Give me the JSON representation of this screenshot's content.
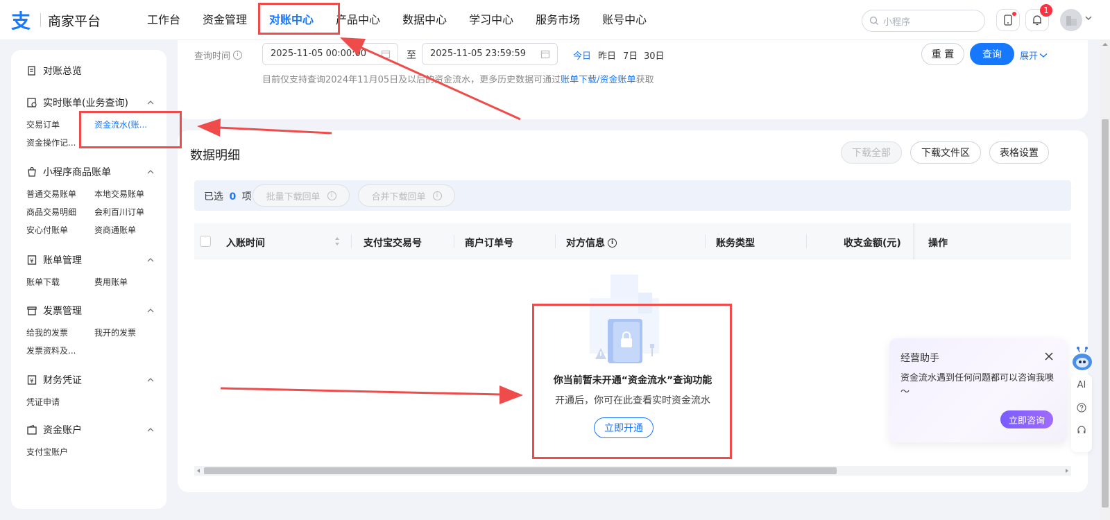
{
  "header": {
    "logo_text": "商家平台",
    "nav": [
      "工作台",
      "资金管理",
      "对账中心",
      "产品中心",
      "数据中心",
      "学习中心",
      "服务市场",
      "账号中心"
    ],
    "active_nav": "对账中心",
    "search_placeholder": "小程序",
    "notification_count": "1"
  },
  "sidebar": {
    "overview": "对账总览",
    "groups": [
      {
        "title": "实时账单(业务查询)",
        "icon": "realtime-bill-icon",
        "items": [
          "交易订单",
          "资金流水(账...",
          "资金操作记..."
        ]
      },
      {
        "title": "小程序商品账单",
        "icon": "miniapp-goods-icon",
        "items": [
          "普通交易账单",
          "本地交易账单",
          "商品交易明细",
          "会利百川订单",
          "安心付账单",
          "资商通账单"
        ]
      },
      {
        "title": "账单管理",
        "icon": "bill-manage-icon",
        "items": [
          "账单下载",
          "费用账单"
        ]
      },
      {
        "title": "发票管理",
        "icon": "invoice-icon",
        "items": [
          "给我的发票",
          "我开的发票",
          "发票资料及..."
        ]
      },
      {
        "title": "财务凭证",
        "icon": "voucher-icon",
        "items": [
          "凭证申请"
        ]
      },
      {
        "title": "资金账户",
        "icon": "wallet-icon",
        "items": [
          "支付宝账户"
        ]
      }
    ],
    "active_item": "资金流水(账..."
  },
  "filter": {
    "label": "查询时间",
    "start": "2025-11-05 00:00:00",
    "to": "至",
    "end": "2025-11-05 23:59:59",
    "quick": [
      "今日",
      "昨日",
      "7日",
      "30日"
    ],
    "hint_prefix": "目前仅支持查询2024年11月05日及以后的资金流水，更多历史数据可通过",
    "hint_link": "账单下载/资金账单",
    "hint_suffix": "获取",
    "reset": "重 置",
    "query": "查询",
    "expand": "展开"
  },
  "detail": {
    "title": "数据明细",
    "download_all": "下载全部",
    "download_area": "下载文件区",
    "table_settings": "表格设置",
    "selected_prefix": "已选",
    "selected_count": "0",
    "selected_suffix": "项",
    "batch_download": "批量下载回单",
    "merge_download": "合并下载回单",
    "columns": [
      "入账时间",
      "支付宝交易号",
      "商户订单号",
      "对方信息",
      "账务类型",
      "收支金额(元)",
      "操作"
    ],
    "empty_title": "你当前暂未开通“资金流水”查询功能",
    "empty_desc": "开通后，你可在此查看实时资金流水",
    "open_now": "立即开通"
  },
  "assistant": {
    "title": "经营助手",
    "message": "资金流水遇到任何问题都可以咨询我噢～",
    "cta": "立即咨询",
    "ai_label": "AI"
  },
  "colors": {
    "primary": "#1677ff",
    "annotation": "#ef4b4b"
  }
}
